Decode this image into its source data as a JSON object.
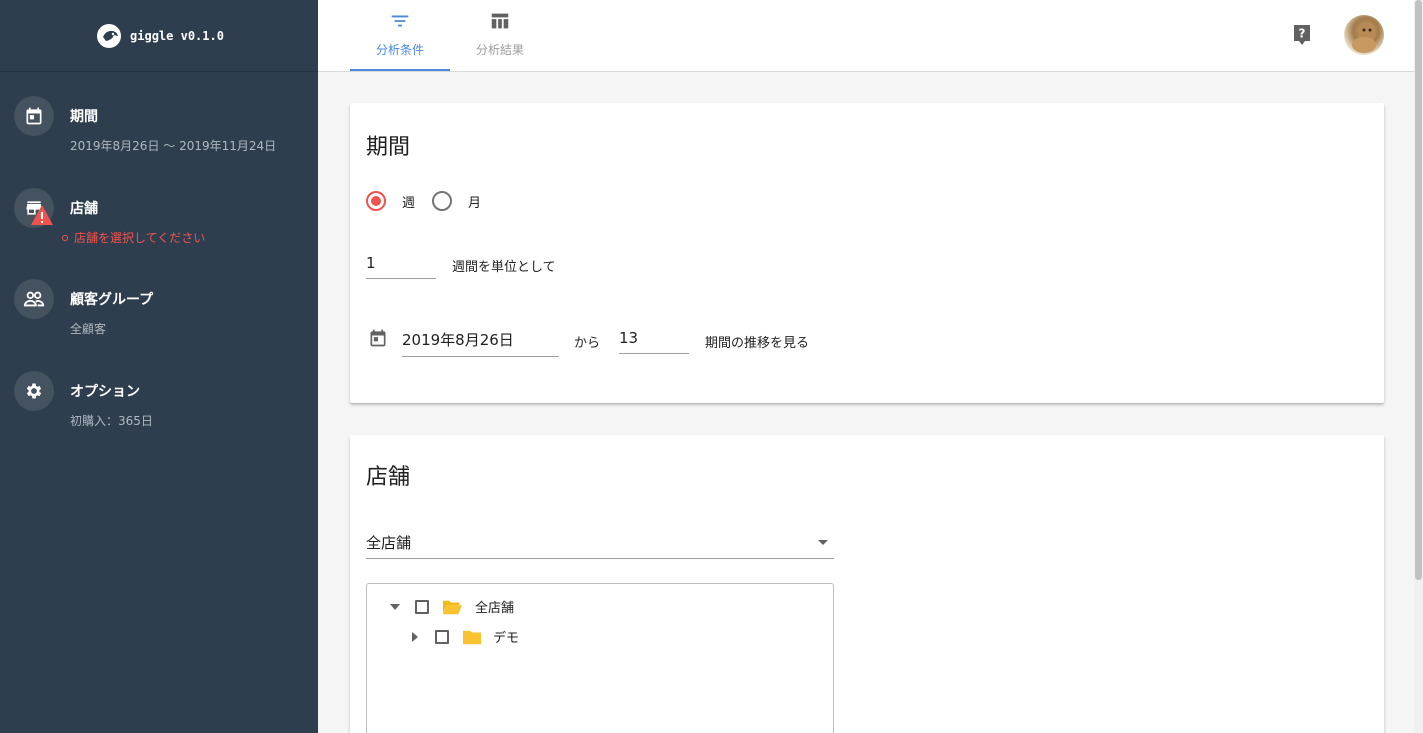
{
  "app": {
    "name": "giggle v0.1.0"
  },
  "sidebar": {
    "items": [
      {
        "title": "期間",
        "sub": "2019年8月26日 〜 2019年11月24日"
      },
      {
        "title": "店舗",
        "error": "店舗を選択してください"
      },
      {
        "title": "顧客グループ",
        "sub": "全顧客"
      },
      {
        "title": "オプション",
        "sub": "初購入：365日"
      }
    ]
  },
  "tabs": [
    {
      "label": "分析条件",
      "active": true
    },
    {
      "label": "分析結果",
      "active": false
    }
  ],
  "period_card": {
    "title": "期間",
    "radio_week": "週",
    "radio_month": "月",
    "selected": "週",
    "unit_value": "1",
    "unit_suffix": "週間を単位として",
    "start_date": "2019年8月26日",
    "from_label": "から",
    "count_value": "13",
    "count_suffix": "期間の推移を見る"
  },
  "store_card": {
    "title": "店舗",
    "select_value": "全店舗",
    "tree": [
      {
        "label": "全店舗",
        "expanded": true,
        "checked": false
      },
      {
        "label": "デモ",
        "expanded": false,
        "checked": false
      }
    ]
  },
  "colors": {
    "sidebar_bg": "#2f3e4e",
    "accent": "#4a89dc",
    "radio_selected": "#ef5350",
    "folder": "#f9c22e",
    "error": "#ef5350"
  }
}
